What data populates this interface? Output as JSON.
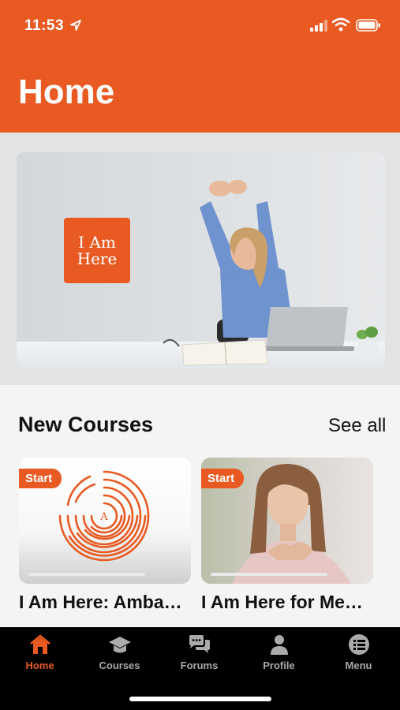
{
  "status_bar": {
    "time": "11:53"
  },
  "header": {
    "title": "Home"
  },
  "hero": {
    "logo_line1": "I Am",
    "logo_line2": "Here"
  },
  "new_courses": {
    "title": "New Courses",
    "see_all": "See all",
    "cards": [
      {
        "badge": "Start",
        "title": "I Am Here: Amba…",
        "progress": 0
      },
      {
        "badge": "Start",
        "title": "I Am Here for Me…",
        "progress": 0
      }
    ]
  },
  "tabs": [
    {
      "label": "Home",
      "icon": "home-icon",
      "active": true
    },
    {
      "label": "Courses",
      "icon": "graduation-cap-icon",
      "active": false
    },
    {
      "label": "Forums",
      "icon": "chat-bubbles-icon",
      "active": false
    },
    {
      "label": "Profile",
      "icon": "person-icon",
      "active": false
    },
    {
      "label": "Menu",
      "icon": "list-icon",
      "active": false
    }
  ],
  "colors": {
    "accent": "#E85A22",
    "tab_inactive": "#AAAAAA",
    "tabbar_bg": "#000000"
  }
}
